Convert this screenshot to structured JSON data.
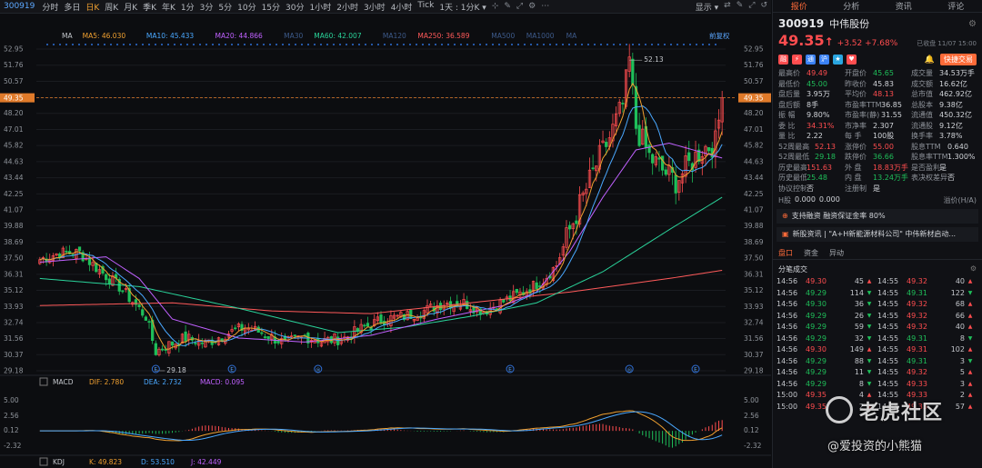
{
  "toolbar": {
    "code": "300919",
    "periods": [
      "分时",
      "多日",
      "日K",
      "周K",
      "月K",
      "季K",
      "年K",
      "1分",
      "3分",
      "5分",
      "10分",
      "15分",
      "30分",
      "1小时",
      "2小时",
      "3小时",
      "4小时",
      "Tick"
    ],
    "active": "日K",
    "interval": "1天 : 1分K ▾",
    "right": [
      "显示 ▾",
      "分析",
      "资讯",
      "评论"
    ]
  },
  "ma_legend": {
    "ma": "MA",
    "ma5": "MA5: 46.030",
    "ma10": "MA10: 45.433",
    "ma20": "MA20: 44.866",
    "ma30": "MA30",
    "ma60": "MA60: 42.007",
    "ma120": "MA120",
    "ma250": "MA250: 36.589",
    "ma500": "MA500",
    "ma1000": "MA1000",
    "maA": "MA",
    "adj": "前复权"
  },
  "macd_legend": {
    "name": "MACD",
    "dif": "DIF: 2.780",
    "dea": "DEA: 2.732",
    "macd": "MACD: 0.095"
  },
  "kdj_legend": {
    "name": "KDJ",
    "k": "K: 49.823",
    "d": "D: 53.510",
    "j": "J: 42.449"
  },
  "colors": {
    "up": "#ff4d4f",
    "down": "#1fbf5a",
    "ma5": "#f0a030",
    "ma10": "#4aa8ff",
    "ma20": "#c061ff",
    "ma60": "#2ad39a",
    "ma250": "#ff5a5a",
    "accent": "#ff6b39"
  },
  "chart_data": {
    "type": "candlestick",
    "y_ticks": [
      "52.95",
      "51.76",
      "50.57",
      "49.35",
      "48.20",
      "47.01",
      "45.82",
      "44.63",
      "43.44",
      "42.25",
      "41.07",
      "39.88",
      "38.69",
      "37.50",
      "36.31",
      "35.12",
      "33.93",
      "32.74",
      "31.56",
      "30.37",
      "29.18"
    ],
    "ylim": [
      29.18,
      52.95
    ],
    "current_price": "49.35",
    "high_label": "52.13",
    "low_label": "29.18",
    "macd_ticks": [
      "5.00",
      "2.56",
      "0.12",
      "-2.32"
    ],
    "markers": [
      "E",
      "E",
      "◎",
      "E",
      "◎",
      "E"
    ],
    "keypoints": [
      {
        "i": 0,
        "v": 37.4
      },
      {
        "i": 6,
        "v": 37.9
      },
      {
        "i": 12,
        "v": 37.9
      },
      {
        "i": 18,
        "v": 36.6
      },
      {
        "i": 24,
        "v": 35.4
      },
      {
        "i": 28,
        "v": 34.3
      },
      {
        "i": 32,
        "v": 33.2
      },
      {
        "i": 35,
        "v": 30.6
      },
      {
        "i": 38,
        "v": 31.0
      },
      {
        "i": 44,
        "v": 31.6
      },
      {
        "i": 50,
        "v": 31.2
      },
      {
        "i": 56,
        "v": 31.9
      },
      {
        "i": 62,
        "v": 32.4
      },
      {
        "i": 68,
        "v": 31.9
      },
      {
        "i": 74,
        "v": 31.2
      },
      {
        "i": 80,
        "v": 31.7
      },
      {
        "i": 86,
        "v": 31.4
      },
      {
        "i": 92,
        "v": 31.6
      },
      {
        "i": 98,
        "v": 32.4
      },
      {
        "i": 104,
        "v": 33.0
      },
      {
        "i": 110,
        "v": 33.2
      },
      {
        "i": 116,
        "v": 33.6
      },
      {
        "i": 122,
        "v": 34.2
      },
      {
        "i": 128,
        "v": 34.2
      },
      {
        "i": 134,
        "v": 33.6
      },
      {
        "i": 140,
        "v": 34.3
      },
      {
        "i": 146,
        "v": 35.0
      },
      {
        "i": 152,
        "v": 35.9
      },
      {
        "i": 156,
        "v": 37.0
      },
      {
        "i": 160,
        "v": 39.6
      },
      {
        "i": 164,
        "v": 42.0
      },
      {
        "i": 168,
        "v": 44.4
      },
      {
        "i": 172,
        "v": 46.4
      },
      {
        "i": 176,
        "v": 48.8
      },
      {
        "i": 178,
        "v": 52.1
      },
      {
        "i": 180,
        "v": 47.2
      },
      {
        "i": 184,
        "v": 45.0
      },
      {
        "i": 188,
        "v": 44.0
      },
      {
        "i": 192,
        "v": 43.2
      },
      {
        "i": 196,
        "v": 44.4
      },
      {
        "i": 200,
        "v": 45.6
      },
      {
        "i": 204,
        "v": 46.0
      },
      {
        "i": 206,
        "v": 49.35
      }
    ],
    "ma_keys": {
      "ma20": [
        [
          0,
          37.2
        ],
        [
          20,
          37.6
        ],
        [
          30,
          36.0
        ],
        [
          40,
          33.0
        ],
        [
          60,
          31.6
        ],
        [
          80,
          31.3
        ],
        [
          100,
          31.8
        ],
        [
          120,
          33.0
        ],
        [
          140,
          34.0
        ],
        [
          150,
          35.0
        ],
        [
          160,
          38.0
        ],
        [
          170,
          42.0
        ],
        [
          180,
          45.5
        ],
        [
          190,
          46.0
        ],
        [
          206,
          44.9
        ]
      ],
      "ma60": [
        [
          0,
          36.0
        ],
        [
          30,
          35.4
        ],
        [
          60,
          33.8
        ],
        [
          90,
          32.0
        ],
        [
          110,
          32.4
        ],
        [
          130,
          33.2
        ],
        [
          150,
          34.2
        ],
        [
          170,
          36.5
        ],
        [
          190,
          39.6
        ],
        [
          206,
          42.0
        ]
      ],
      "ma250": [
        [
          0,
          34.0
        ],
        [
          40,
          34.2
        ],
        [
          70,
          33.6
        ],
        [
          100,
          33.4
        ],
        [
          130,
          34.2
        ],
        [
          160,
          35.0
        ],
        [
          190,
          36.0
        ],
        [
          206,
          36.6
        ]
      ]
    }
  },
  "quote": {
    "code": "300919",
    "name": "中伟股份",
    "price": "49.35",
    "arrow": "↑",
    "change": "+3.52 +7.68%",
    "timestamp": "已收盘 11/07 15:00",
    "quick_trade": "快捷交易",
    "grid": [
      [
        "最高价",
        "49.49",
        "r"
      ],
      [
        "开盘价",
        "45.65",
        "g"
      ],
      [
        "成交量",
        "34.53万手",
        "w"
      ],
      [
        "最低价",
        "45.00",
        "g"
      ],
      [
        "昨收价",
        "45.83",
        "w"
      ],
      [
        "成交额",
        "16.62亿",
        "w"
      ],
      [
        "盘后量",
        "3.95万",
        "w"
      ],
      [
        "平均价",
        "48.13",
        "r"
      ],
      [
        "总市值",
        "462.92亿",
        "w"
      ],
      [
        "盘后额",
        "8手",
        "w"
      ],
      [
        "市盈率TTM",
        "36.85",
        "w"
      ],
      [
        "总股本",
        "9.38亿",
        "w"
      ],
      [
        "振 幅",
        "9.80%",
        "w"
      ],
      [
        "市盈率(静)",
        "31.55",
        "w"
      ],
      [
        "流通值",
        "450.32亿",
        "w"
      ],
      [
        "委 比",
        "34.31%",
        "r"
      ],
      [
        "市净率",
        "2.307",
        "w"
      ],
      [
        "流通股",
        "9.12亿",
        "w"
      ],
      [
        "量 比",
        "2.22",
        "w"
      ],
      [
        "每 手",
        "100股",
        "w"
      ],
      [
        "换手率",
        "3.78%",
        "w"
      ],
      [
        "52周最高",
        "52.13",
        "r"
      ],
      [
        "涨停价",
        "55.00",
        "r"
      ],
      [
        "股息TTM",
        "0.640",
        "w"
      ],
      [
        "52周最低",
        "29.18",
        "g"
      ],
      [
        "跌停价",
        "36.66",
        "g"
      ],
      [
        "股息率TTM",
        "1.300%",
        "w"
      ],
      [
        "历史最高",
        "151.63",
        "r"
      ],
      [
        "外 盘",
        "18.83万手",
        "r"
      ],
      [
        "是否盈利",
        "是",
        "w"
      ],
      [
        "历史最低",
        "25.48",
        "g"
      ],
      [
        "内 盘",
        "13.24万手",
        "g"
      ],
      [
        "表决权差异",
        "否",
        "w"
      ],
      [
        "协议控制",
        "否",
        "w"
      ],
      [
        "注册制",
        "是",
        "w"
      ],
      [
        "",
        "",
        " "
      ]
    ],
    "hk_label": "H股",
    "hk_v1": "0.000",
    "hk_v2": "0.000",
    "hk_right": "溢价(H/A)",
    "margin": "支持融资  融资保证金率 80%",
    "news": "新股资讯 |  \"A+H新能源材料公司\" 中伟新材启动...",
    "subtabs": [
      "盘口",
      "资金",
      "异动"
    ],
    "ticks_title": "分笔成交",
    "ticks_left": [
      [
        "14:56",
        "49.30",
        "45",
        "r"
      ],
      [
        "14:56",
        "49.29",
        "114",
        "g"
      ],
      [
        "14:56",
        "49.30",
        "36",
        "g"
      ],
      [
        "14:56",
        "49.29",
        "26",
        "g"
      ],
      [
        "14:56",
        "49.29",
        "59",
        "g"
      ],
      [
        "14:56",
        "49.29",
        "32",
        "g"
      ],
      [
        "14:56",
        "49.30",
        "149",
        "r"
      ],
      [
        "14:56",
        "49.29",
        "88",
        "g"
      ],
      [
        "14:56",
        "49.29",
        "11",
        "g"
      ],
      [
        "14:56",
        "49.29",
        "8",
        "g"
      ],
      [
        "15:00",
        "49.35",
        "4",
        "r"
      ],
      [
        "15:00",
        "49.35",
        "2",
        "r"
      ]
    ],
    "ticks_right": [
      [
        "14:55",
        "49.32",
        "40",
        "r"
      ],
      [
        "14:55",
        "49.31",
        "122",
        "g"
      ],
      [
        "14:55",
        "49.32",
        "68",
        "r"
      ],
      [
        "14:55",
        "49.32",
        "66",
        "r"
      ],
      [
        "14:55",
        "49.32",
        "40",
        "r"
      ],
      [
        "14:55",
        "49.31",
        "8",
        "g"
      ],
      [
        "14:55",
        "49.31",
        "102",
        "r"
      ],
      [
        "14:55",
        "49.31",
        "3",
        "g"
      ],
      [
        "14:55",
        "49.32",
        "5",
        "r"
      ],
      [
        "14:55",
        "49.33",
        "3",
        "r"
      ],
      [
        "14:55",
        "49.33",
        "2",
        "r"
      ],
      [
        "14:55",
        "49.33",
        "57",
        "r"
      ]
    ]
  },
  "watermark": {
    "brand": "老虎社区",
    "user": "@爱投资的小熊猫"
  }
}
